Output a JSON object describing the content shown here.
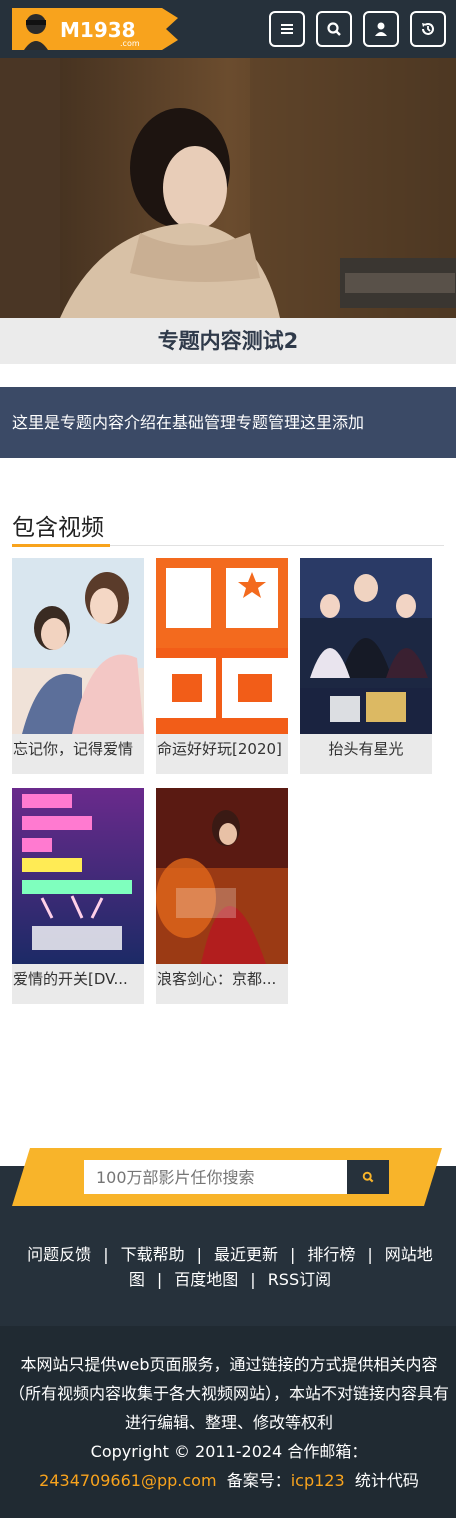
{
  "header": {
    "logo_text": "M1938",
    "logo_sub": ".com",
    "buttons": [
      {
        "icon": "menu-icon"
      },
      {
        "icon": "search-icon"
      },
      {
        "icon": "user-icon"
      },
      {
        "icon": "history-icon"
      }
    ]
  },
  "topic": {
    "title": "专题内容测试2",
    "intro": "这里是专题内容介绍在基础管理专题管理这里添加"
  },
  "section": {
    "title": "包含视频"
  },
  "videos": [
    {
      "title": "忘记你，记得爱情"
    },
    {
      "title": "命运好好玩[2020]"
    },
    {
      "title": "抬头有星光"
    },
    {
      "title": "爱情的开关[DV..."
    },
    {
      "title": "浪客剑心：京都..."
    }
  ],
  "search": {
    "placeholder": "100万部影片任你搜索"
  },
  "footer_links": {
    "feedback": "问题反馈",
    "download_help": "下载帮助",
    "latest": "最近更新",
    "ranking": "排行榜",
    "sitemap": "网站地图",
    "baidu_map": "百度地图",
    "rss": "RSS订阅",
    "sep": "|"
  },
  "footer_info": {
    "line1": "本网站只提供web页面服务，通过链接的方式提供相关内容（所有视频内容收集于各大视频网站），本站不对链接内容具有进行编辑、整理、修改等权利",
    "copyright": "Copyright © 2011-2024  合作邮箱：",
    "email": "2434709661@pp.com",
    "icp_label": "备案号：",
    "icp": "icp123",
    "stats": "统计代码"
  },
  "colors": {
    "header_bg": "#26313b",
    "accent": "#f8a31d",
    "intro_bg": "#3b4a66"
  }
}
